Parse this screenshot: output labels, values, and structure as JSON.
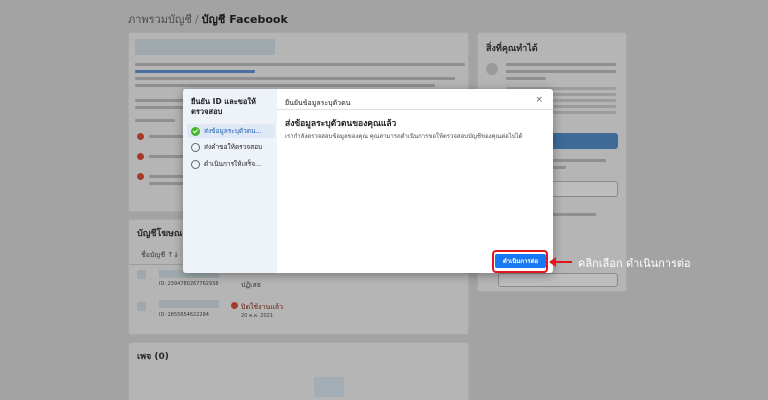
{
  "header": {
    "breadcrumb_root": "ภาพรวมบัญชี",
    "breadcrumb_sep": "/",
    "breadcrumb_current": "บัญชี Facebook"
  },
  "background": {
    "right_panel_title": "สิ่งที่คุณทำได้",
    "ad_accounts_title": "บัญชีโฆษณา",
    "pages_title": "เพจ (0)",
    "row1_id": "ID: 2394780267762938",
    "row2_id": "ID: 2855654622284",
    "row2_status": "ปิดใช้งานแล้ว",
    "row2_date": "20 ต.ค. 2021",
    "account_id_col": "ชื่อบัญชี ↑↓",
    "row1_status": "ปฏิเสธ"
  },
  "modal": {
    "side_title": "ยืนยัน ID และขอให้ตรวจสอบ",
    "steps": [
      {
        "label": "ส่งข้อมูลระบุตัวตน..."
      },
      {
        "label": "ส่งคำขอให้ตรวจสอบ"
      },
      {
        "label": "ดำเนินการให้เสร็จ..."
      }
    ],
    "header": "ยืนยันข้อมูลระบุตัวตน",
    "close": "×",
    "title": "ส่งข้อมูลระบุตัวตนของคุณแล้ว",
    "body": "เรากำลังตรวจสอบข้อมูลของคุณ คุณสามารถดำเนินการขอให้ตรวจสอบบัญชีของคุณต่อไปได้",
    "continue_label": "ดำเนินการต่อ"
  },
  "annotation": {
    "callout": "คลิกเลือก ดำเนินการต่อ",
    "color": "#e1171e"
  },
  "colors": {
    "primary": "#1877f2",
    "success": "#42b72a"
  }
}
